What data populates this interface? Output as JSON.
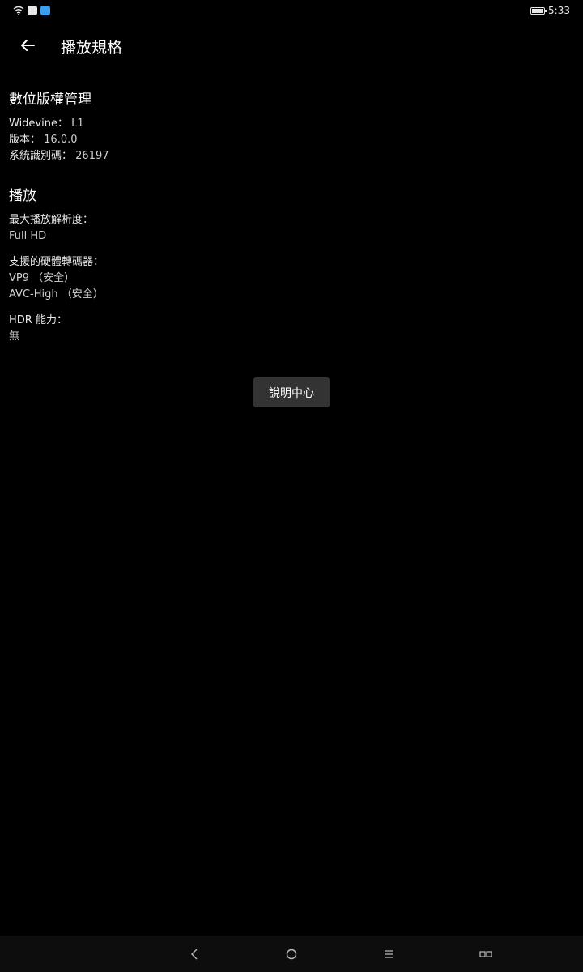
{
  "status_bar": {
    "time": "5:33",
    "icons": [
      "wifi-icon",
      "app-notification-icon",
      "app-notification-icon",
      "battery-icon"
    ],
    "colors": {
      "badge_1": "#e8e8e8",
      "badge_2": "#3aa0f0"
    }
  },
  "app_bar": {
    "back_icon": "arrow-left-icon",
    "title": "播放規格"
  },
  "drm": {
    "heading": "數位版權管理",
    "widevine_label": "Widevine：",
    "widevine_value": "L1",
    "version_label": "版本：",
    "version_value": "16.0.0",
    "system_id_label": "系統識別碼：",
    "system_id_value": "26197"
  },
  "playback": {
    "heading": "播放",
    "max_resolution_label": "最大播放解析度：",
    "max_resolution_value": "Full HD",
    "decoders_label": "支援的硬體轉碼器：",
    "decoders": [
      "VP9 （安全）",
      "AVC-High （安全）"
    ],
    "hdr_label": "HDR 能力：",
    "hdr_value": "無"
  },
  "help_button": {
    "label": "說明中心",
    "color": "#333333"
  },
  "nav_bar": {
    "buttons": [
      "back-icon",
      "home-icon",
      "menu-icon",
      "recents-icon"
    ]
  }
}
